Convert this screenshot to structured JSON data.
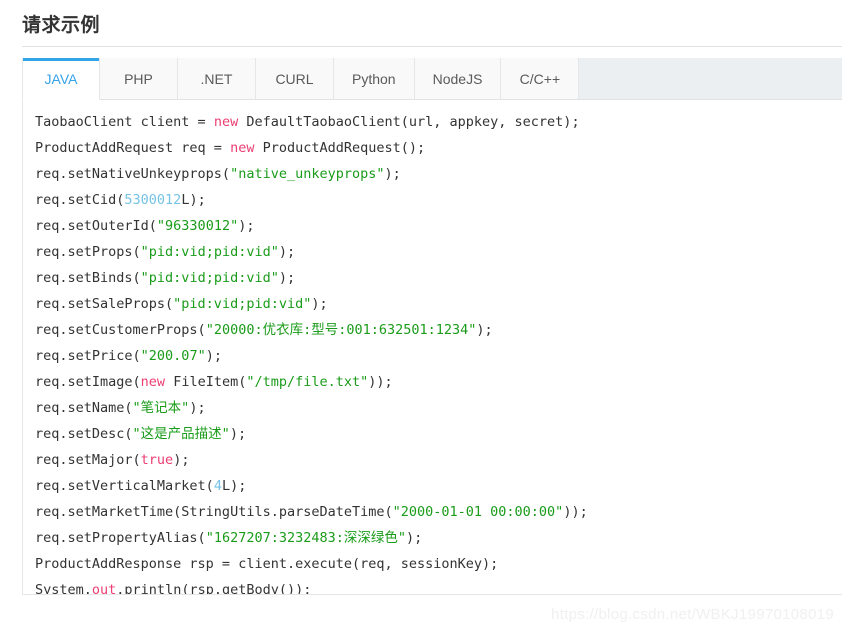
{
  "header": {
    "title": "请求示例"
  },
  "tabs": {
    "items": [
      {
        "label": "JAVA",
        "active": true
      },
      {
        "label": "PHP",
        "active": false
      },
      {
        "label": ".NET",
        "active": false
      },
      {
        "label": "CURL",
        "active": false
      },
      {
        "label": "Python",
        "active": false
      },
      {
        "label": "NodeJS",
        "active": false
      },
      {
        "label": "C/C++",
        "active": false
      }
    ]
  },
  "colors": {
    "accent": "#32a5e7",
    "keyword": "#ec3e72",
    "string": "#1a9c1a",
    "number": "#76c3e5",
    "text": "#333333",
    "tab_active_text": "#36a3e8",
    "tab_inactive_text": "#5a5a5a",
    "tab_strip_bg": "#eceff1"
  },
  "code": {
    "language": "JAVA",
    "lines": [
      [
        {
          "t": "txt",
          "v": "TaobaoClient client = "
        },
        {
          "t": "kw",
          "v": "new"
        },
        {
          "t": "txt",
          "v": " DefaultTaobaoClient(url, appkey, secret);"
        }
      ],
      [
        {
          "t": "txt",
          "v": "ProductAddRequest req = "
        },
        {
          "t": "kw",
          "v": "new"
        },
        {
          "t": "txt",
          "v": " ProductAddRequest();"
        }
      ],
      [
        {
          "t": "txt",
          "v": "req.setNativeUnkeyprops("
        },
        {
          "t": "str",
          "v": "\"native_unkeyprops\""
        },
        {
          "t": "txt",
          "v": ");"
        }
      ],
      [
        {
          "t": "txt",
          "v": "req.setCid("
        },
        {
          "t": "num",
          "v": "5300012"
        },
        {
          "t": "txt",
          "v": "L);"
        }
      ],
      [
        {
          "t": "txt",
          "v": "req.setOuterId("
        },
        {
          "t": "str",
          "v": "\"96330012\""
        },
        {
          "t": "txt",
          "v": ");"
        }
      ],
      [
        {
          "t": "txt",
          "v": "req.setProps("
        },
        {
          "t": "str",
          "v": "\"pid:vid;pid:vid\""
        },
        {
          "t": "txt",
          "v": ");"
        }
      ],
      [
        {
          "t": "txt",
          "v": "req.setBinds("
        },
        {
          "t": "str",
          "v": "\"pid:vid;pid:vid\""
        },
        {
          "t": "txt",
          "v": ");"
        }
      ],
      [
        {
          "t": "txt",
          "v": "req.setSaleProps("
        },
        {
          "t": "str",
          "v": "\"pid:vid;pid:vid\""
        },
        {
          "t": "txt",
          "v": ");"
        }
      ],
      [
        {
          "t": "txt",
          "v": "req.setCustomerProps("
        },
        {
          "t": "str",
          "v": "\"20000:优衣库:型号:001:632501:1234\""
        },
        {
          "t": "txt",
          "v": ");"
        }
      ],
      [
        {
          "t": "txt",
          "v": "req.setPrice("
        },
        {
          "t": "str",
          "v": "\"200.07\""
        },
        {
          "t": "txt",
          "v": ");"
        }
      ],
      [
        {
          "t": "txt",
          "v": "req.setImage("
        },
        {
          "t": "kw",
          "v": "new"
        },
        {
          "t": "txt",
          "v": " FileItem("
        },
        {
          "t": "str",
          "v": "\"/tmp/file.txt\""
        },
        {
          "t": "txt",
          "v": "));"
        }
      ],
      [
        {
          "t": "txt",
          "v": "req.setName("
        },
        {
          "t": "str",
          "v": "\"笔记本\""
        },
        {
          "t": "txt",
          "v": ");"
        }
      ],
      [
        {
          "t": "txt",
          "v": "req.setDesc("
        },
        {
          "t": "str",
          "v": "\"这是产品描述\""
        },
        {
          "t": "txt",
          "v": ");"
        }
      ],
      [
        {
          "t": "txt",
          "v": "req.setMajor("
        },
        {
          "t": "kw",
          "v": "true"
        },
        {
          "t": "txt",
          "v": ");"
        }
      ],
      [
        {
          "t": "txt",
          "v": "req.setVerticalMarket("
        },
        {
          "t": "num",
          "v": "4"
        },
        {
          "t": "txt",
          "v": "L);"
        }
      ],
      [
        {
          "t": "txt",
          "v": "req.setMarketTime(StringUtils.parseDateTime("
        },
        {
          "t": "str",
          "v": "\"2000-01-01 00:00:00\""
        },
        {
          "t": "txt",
          "v": "));"
        }
      ],
      [
        {
          "t": "txt",
          "v": "req.setPropertyAlias("
        },
        {
          "t": "str",
          "v": "\"1627207:3232483:深深绿色\""
        },
        {
          "t": "txt",
          "v": ");"
        }
      ],
      [
        {
          "t": "txt",
          "v": "ProductAddResponse rsp = client.execute(req, sessionKey);"
        }
      ],
      [
        {
          "t": "txt",
          "v": "System."
        },
        {
          "t": "kw",
          "v": "out"
        },
        {
          "t": "txt",
          "v": ".println(rsp.getBody());"
        }
      ]
    ]
  },
  "watermark": {
    "text": "https://blog.csdn.net/WBKJ19970108019"
  }
}
